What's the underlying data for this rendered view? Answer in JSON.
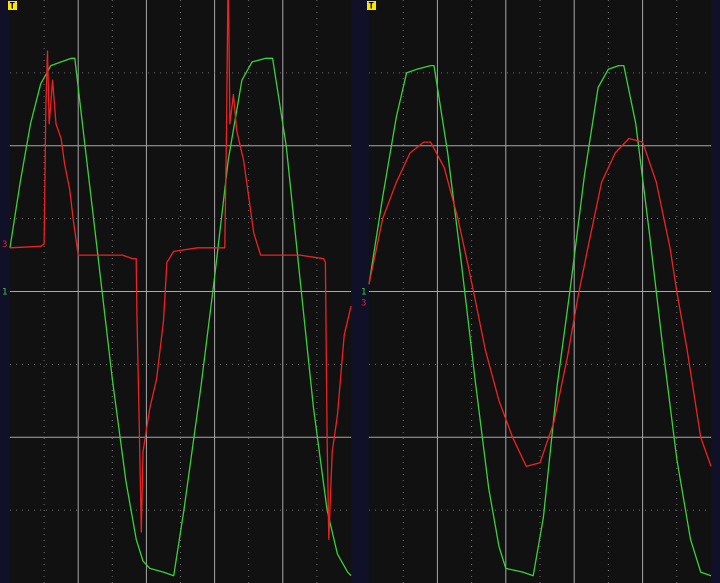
{
  "colors": {
    "background": "#101028",
    "screen": "#111111",
    "grid_major": "#a8a8a8",
    "grid_minor": "#6e6e6e",
    "ch1": "#3ad13a",
    "ch3": "#ee2222",
    "trigger_bg": "#ffe600",
    "trigger_fg": "#000000"
  },
  "chart_data": [
    {
      "type": "line",
      "panel": "left",
      "trigger_label": "T",
      "grid": true,
      "divisions": {
        "x": 10,
        "y": 8
      },
      "xlim": [
        0,
        10
      ],
      "ylim": [
        -4,
        4
      ],
      "reference_markers": [
        {
          "label": "3",
          "channel": "ch3",
          "level": 0.65
        },
        {
          "label": "1",
          "channel": "ch1",
          "level": 0.0
        }
      ],
      "series": [
        {
          "channel": "ch1",
          "color": "#3ad13a",
          "points": [
            [
              0,
              0.6
            ],
            [
              0.3,
              1.5
            ],
            [
              0.6,
              2.3
            ],
            [
              0.9,
              2.85
            ],
            [
              1.2,
              3.1
            ],
            [
              1.5,
              3.15
            ],
            [
              1.8,
              3.2
            ],
            [
              1.9,
              3.2
            ],
            [
              2.2,
              2.0
            ],
            [
              2.6,
              0.4
            ],
            [
              3.0,
              -1.2
            ],
            [
              3.4,
              -2.6
            ],
            [
              3.7,
              -3.4
            ],
            [
              3.9,
              -3.7
            ],
            [
              4.1,
              -3.8
            ],
            [
              4.5,
              -3.85
            ],
            [
              4.8,
              -3.9
            ],
            [
              5.1,
              -3.0
            ],
            [
              5.6,
              -1.3
            ],
            [
              6.0,
              0.2
            ],
            [
              6.4,
              1.8
            ],
            [
              6.8,
              2.9
            ],
            [
              7.1,
              3.15
            ],
            [
              7.5,
              3.2
            ],
            [
              7.7,
              3.2
            ],
            [
              8.1,
              2.0
            ],
            [
              8.5,
              0.2
            ],
            [
              8.9,
              -1.6
            ],
            [
              9.3,
              -3.0
            ],
            [
              9.6,
              -3.6
            ],
            [
              9.9,
              -3.85
            ],
            [
              10,
              -3.9
            ]
          ]
        },
        {
          "channel": "ch3",
          "color": "#ee2222",
          "points": [
            [
              0,
              0.6
            ],
            [
              0.9,
              0.62
            ],
            [
              1.0,
              0.65
            ],
            [
              1.05,
              2.5
            ],
            [
              1.1,
              3.3
            ],
            [
              1.15,
              2.3
            ],
            [
              1.25,
              2.9
            ],
            [
              1.35,
              2.3
            ],
            [
              1.5,
              2.1
            ],
            [
              1.6,
              1.75
            ],
            [
              1.75,
              1.4
            ],
            [
              1.85,
              1.0
            ],
            [
              2.0,
              0.5
            ],
            [
              2.6,
              0.5
            ],
            [
              3.3,
              0.5
            ],
            [
              3.6,
              0.45
            ],
            [
              3.7,
              0.45
            ],
            [
              3.72,
              -0.3
            ],
            [
              3.78,
              -1.6
            ],
            [
              3.85,
              -3.3
            ],
            [
              3.9,
              -2.2
            ],
            [
              4.1,
              -1.6
            ],
            [
              4.3,
              -1.2
            ],
            [
              4.5,
              -0.4
            ],
            [
              4.6,
              0.4
            ],
            [
              4.8,
              0.55
            ],
            [
              5.5,
              0.6
            ],
            [
              6.1,
              0.6
            ],
            [
              6.3,
              0.6
            ],
            [
              6.35,
              2.2
            ],
            [
              6.4,
              4.5
            ],
            [
              6.45,
              2.3
            ],
            [
              6.55,
              2.7
            ],
            [
              6.65,
              2.2
            ],
            [
              6.85,
              1.8
            ],
            [
              7.0,
              1.3
            ],
            [
              7.15,
              0.8
            ],
            [
              7.35,
              0.5
            ],
            [
              8.5,
              0.5
            ],
            [
              9.2,
              0.45
            ],
            [
              9.25,
              0.4
            ],
            [
              9.3,
              -2.0
            ],
            [
              9.35,
              -3.4
            ],
            [
              9.45,
              -2.2
            ],
            [
              9.6,
              -1.7
            ],
            [
              9.8,
              -0.6
            ],
            [
              10,
              -0.2
            ]
          ]
        }
      ]
    },
    {
      "type": "line",
      "panel": "right",
      "trigger_label": "T",
      "grid": true,
      "divisions": {
        "x": 10,
        "y": 8
      },
      "xlim": [
        0,
        10
      ],
      "ylim": [
        -4,
        4
      ],
      "reference_markers": [
        {
          "label": "1",
          "channel": "ch1",
          "level": 0.0
        },
        {
          "label": "3",
          "channel": "ch3",
          "level": -0.15
        }
      ],
      "series": [
        {
          "channel": "ch1",
          "color": "#3ad13a",
          "points": [
            [
              0,
              0.1
            ],
            [
              0.4,
              1.3
            ],
            [
              0.8,
              2.4
            ],
            [
              1.1,
              3.0
            ],
            [
              1.4,
              3.05
            ],
            [
              1.8,
              3.1
            ],
            [
              1.9,
              3.1
            ],
            [
              2.3,
              1.9
            ],
            [
              2.7,
              0.4
            ],
            [
              3.1,
              -1.2
            ],
            [
              3.5,
              -2.7
            ],
            [
              3.8,
              -3.5
            ],
            [
              4.0,
              -3.8
            ],
            [
              4.5,
              -3.85
            ],
            [
              4.8,
              -3.9
            ],
            [
              5.1,
              -3.1
            ],
            [
              5.5,
              -1.3
            ],
            [
              5.9,
              0.1
            ],
            [
              6.3,
              1.6
            ],
            [
              6.7,
              2.8
            ],
            [
              7.0,
              3.05
            ],
            [
              7.3,
              3.1
            ],
            [
              7.45,
              3.1
            ],
            [
              7.8,
              2.3
            ],
            [
              8.2,
              0.8
            ],
            [
              8.6,
              -0.8
            ],
            [
              9.0,
              -2.3
            ],
            [
              9.4,
              -3.4
            ],
            [
              9.7,
              -3.85
            ],
            [
              10,
              -3.9
            ]
          ]
        },
        {
          "channel": "ch3",
          "color": "#ee2222",
          "points": [
            [
              0,
              0.1
            ],
            [
              0.4,
              1.0
            ],
            [
              0.8,
              1.5
            ],
            [
              1.2,
              1.9
            ],
            [
              1.6,
              2.05
            ],
            [
              1.8,
              2.05
            ],
            [
              2.2,
              1.7
            ],
            [
              2.6,
              1.0
            ],
            [
              2.9,
              0.35
            ],
            [
              3.1,
              -0.1
            ],
            [
              3.4,
              -0.8
            ],
            [
              3.8,
              -1.5
            ],
            [
              4.2,
              -2.0
            ],
            [
              4.6,
              -2.4
            ],
            [
              5.0,
              -2.35
            ],
            [
              5.4,
              -1.8
            ],
            [
              5.8,
              -0.9
            ],
            [
              6.1,
              -0.1
            ],
            [
              6.4,
              0.6
            ],
            [
              6.8,
              1.5
            ],
            [
              7.2,
              1.9
            ],
            [
              7.6,
              2.1
            ],
            [
              8.0,
              2.05
            ],
            [
              8.4,
              1.5
            ],
            [
              8.8,
              0.6
            ],
            [
              9.0,
              0.0
            ],
            [
              9.3,
              -0.8
            ],
            [
              9.7,
              -2.0
            ],
            [
              10,
              -2.4
            ]
          ]
        }
      ]
    }
  ]
}
